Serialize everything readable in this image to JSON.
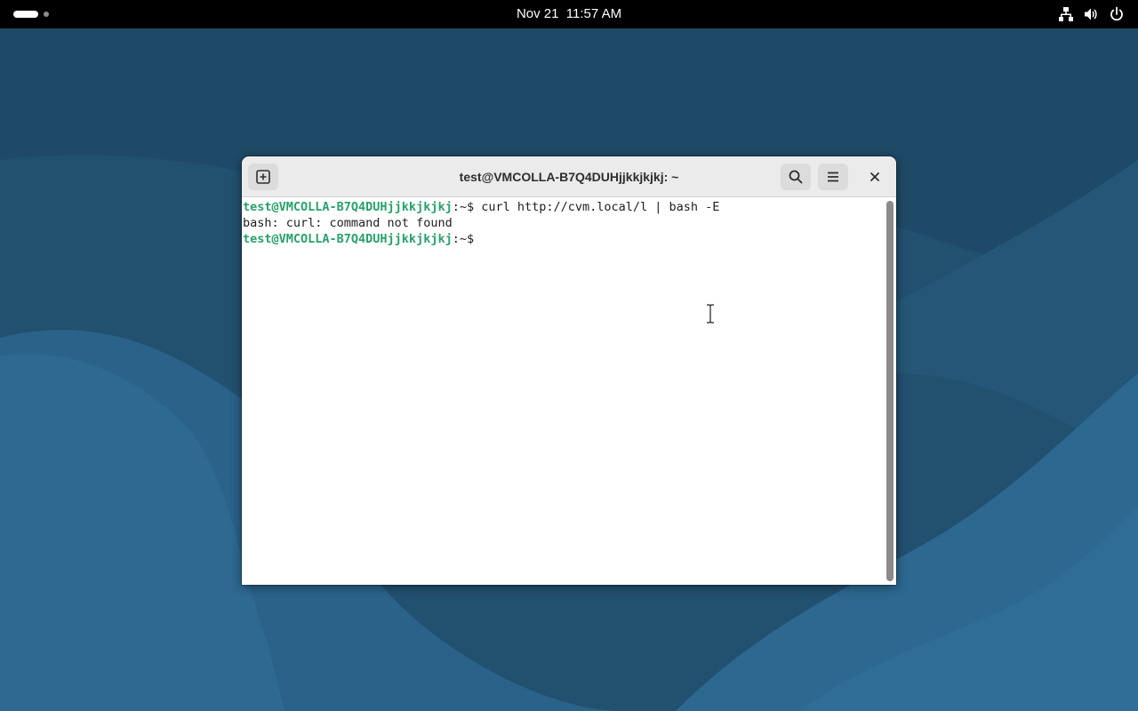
{
  "topbar": {
    "clock": "Nov 21  11:57 AM",
    "activities_icon": "workspace-indicator-icon",
    "network_icon": "network-wired-icon",
    "volume_icon": "volume-icon",
    "power_icon": "power-icon"
  },
  "terminal": {
    "title": "test@VMCOLLA-B7Q4DUHjjkkjkjkj: ~",
    "new_tab_icon": "new-tab-icon",
    "search_icon": "search-icon",
    "menu_icon": "hamburger-menu-icon",
    "close_icon": "close-icon",
    "lines": [
      {
        "prompt": "test@VMCOLLA-B7Q4DUHjjkkjkjkj",
        "suffix": ":~$ ",
        "command": "curl http://cvm.local/l | bash -E"
      },
      {
        "output": "bash: curl: command not found"
      },
      {
        "prompt": "test@VMCOLLA-B7Q4DUHjjkkjkjkj",
        "suffix": ":~$ ",
        "command": ""
      }
    ]
  },
  "colors": {
    "topbar_bg": "#000000",
    "prompt_green": "#26a269",
    "terminal_bg": "#ffffff",
    "headerbar_bg": "#ebebeb",
    "wallpaper_dark": "#1d4661",
    "wallpaper_light": "#2b6a92"
  }
}
